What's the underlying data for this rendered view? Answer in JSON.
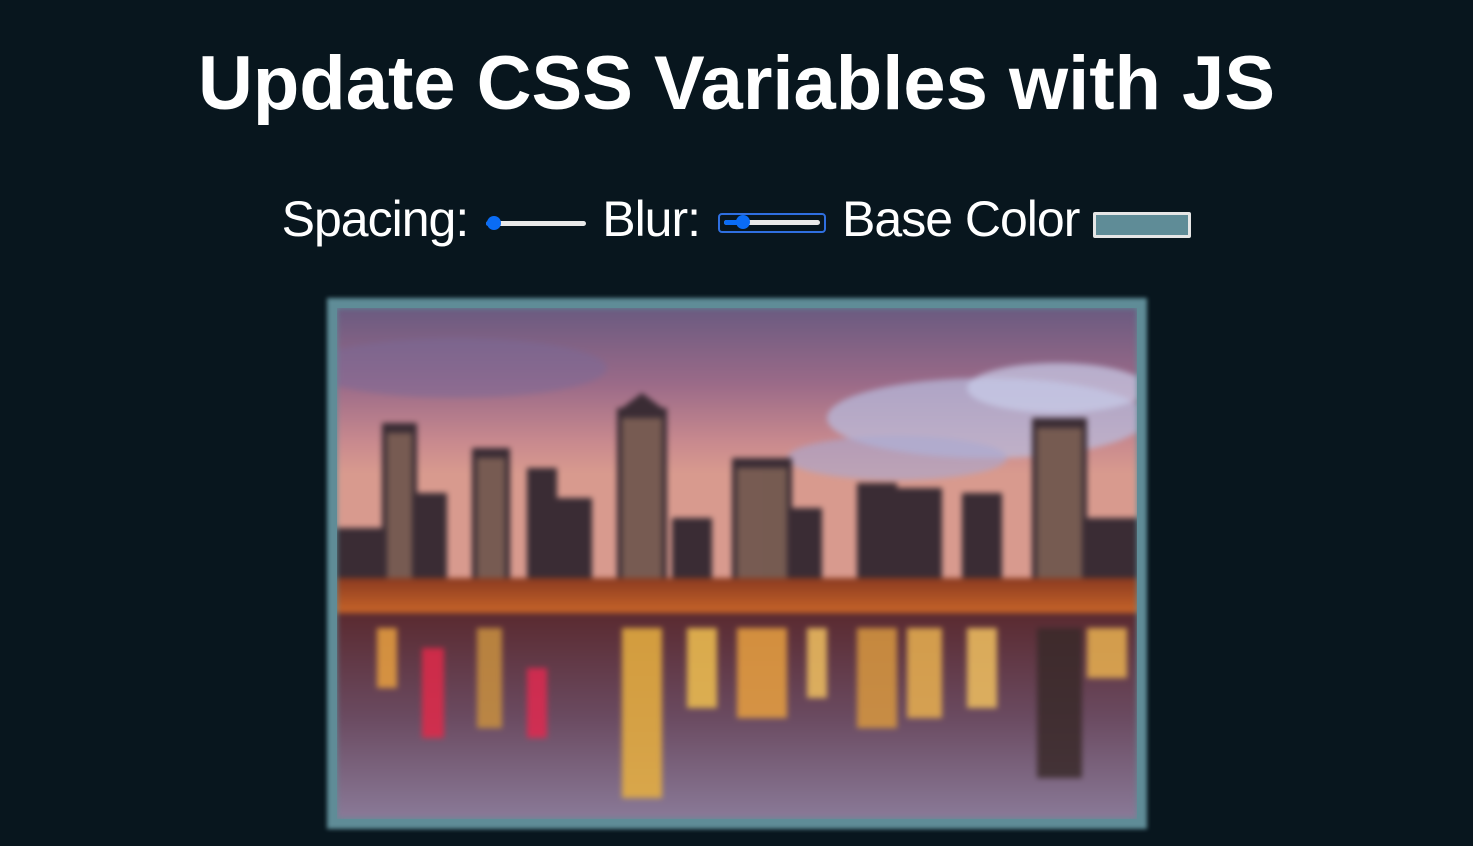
{
  "title": "Update CSS Variables with JS",
  "controls": {
    "spacing": {
      "label": "Spacing:",
      "value": 0.08
    },
    "blur": {
      "label": "Blur:",
      "value": 0.2
    },
    "base_color": {
      "label": "Base Color",
      "value": "#5f8c97"
    }
  },
  "colors": {
    "background": "#08161e",
    "accent": "#0a6cf5"
  },
  "image": {
    "alt": "city-skyline-at-dusk"
  }
}
